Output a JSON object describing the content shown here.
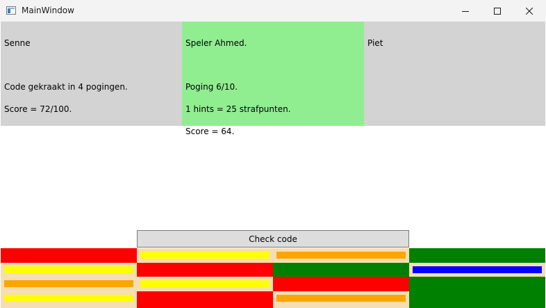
{
  "window": {
    "title": "MainWindow",
    "icon": "app-window-icon",
    "controls": [
      "minimize-icon",
      "maximize-icon",
      "close-icon"
    ]
  },
  "players": [
    {
      "name": "Senne",
      "lines": [
        "Code gekraakt in 4 pogingen.",
        "Score = 72/100."
      ],
      "background": "#d3d3d3"
    },
    {
      "name": "Speler Ahmed.",
      "lines": [
        "Poging 6/10.",
        "1 hints = 25 strafpunten.",
        "Score = 64."
      ],
      "background": "#90ee90",
      "active": true
    },
    {
      "name": "Piet",
      "lines": [],
      "background": "#d3d3d3"
    }
  ],
  "check_button": {
    "label": "Check code"
  },
  "colors": {
    "red": "#ff0000",
    "green": "#008000",
    "yellow": "#ffff00",
    "orange": "#ffa500",
    "blue": "#0000ff",
    "wheat": "#f5deb3"
  },
  "board": {
    "columns": [
      [
        "red",
        "yellow",
        "orange",
        "yellow"
      ],
      [
        "yellow",
        "red",
        "yellow",
        "red"
      ],
      [
        "orange",
        "green",
        "red",
        "orange"
      ],
      [
        "green",
        "blue",
        "green",
        "green"
      ]
    ],
    "slot_styles": [
      [
        "block",
        "bar",
        "bar",
        "bar"
      ],
      [
        "bar",
        "block",
        "bar",
        "block"
      ],
      [
        "bar",
        "block",
        "block",
        "bar"
      ],
      [
        "block",
        "bar",
        "block",
        "block"
      ]
    ]
  }
}
